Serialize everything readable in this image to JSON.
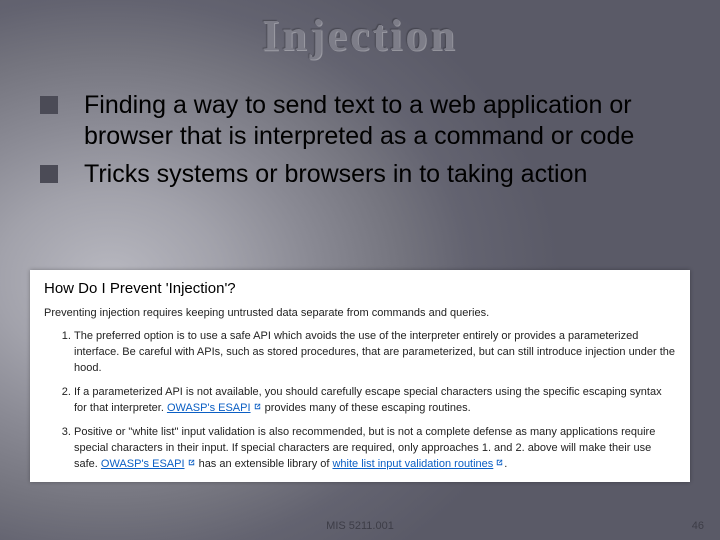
{
  "title": "Injection",
  "bullets": [
    "Finding a way to send text to a web application or browser that is interpreted as a command or code",
    "Tricks systems or browsers in to taking action"
  ],
  "clip": {
    "heading": "How Do I Prevent 'Injection'?",
    "intro": "Preventing injection requires keeping untrusted data separate from commands and queries.",
    "items": [
      {
        "text_pre": "The preferred option is to use a safe API which avoids the use of the interpreter entirely or provides a parameterized interface. Be careful with APIs, such as stored procedures, that are parameterized, but can still introduce injection under the hood.",
        "link": "",
        "text_post": ""
      },
      {
        "text_pre": "If a parameterized API is not available, you should carefully escape special characters using the specific escaping syntax for that interpreter. ",
        "link": "OWASP's ESAPI",
        "text_post": " provides many of these escaping routines."
      },
      {
        "text_pre": "Positive or \"white list\" input validation is also recommended, but is not a complete defense as many applications require special characters in their input. If special characters are required, only approaches 1. and 2. above will make their use safe. ",
        "link": "OWASP's ESAPI",
        "text_post": " has an extensible library of ",
        "link2": "white list input validation routines",
        "text_end": "."
      }
    ]
  },
  "footer": {
    "course": "MIS 5211.001",
    "page": "46"
  }
}
